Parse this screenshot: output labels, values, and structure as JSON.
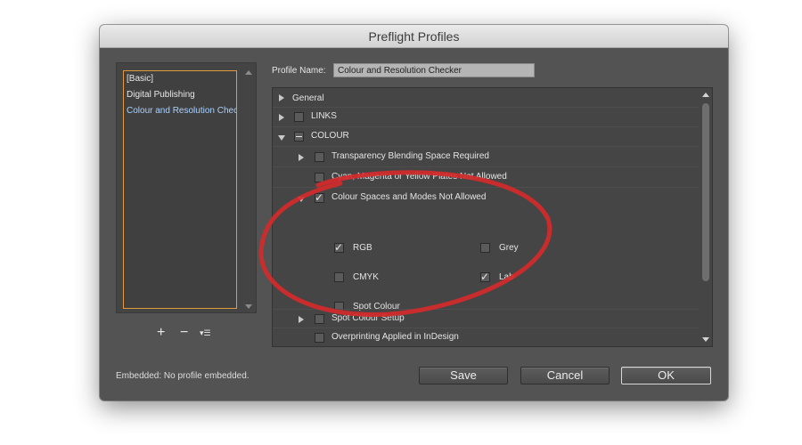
{
  "dialog": {
    "title": "Preflight Profiles"
  },
  "profiles": {
    "items": [
      "[Basic]",
      "Digital Publishing",
      "Colour and Resolution Chec"
    ],
    "selected_index": 2
  },
  "list_tools": {
    "add": "+",
    "remove": "−",
    "menu": "▾☰"
  },
  "profile_name": {
    "label": "Profile Name:",
    "value": "Colour and Resolution Checker"
  },
  "tree": {
    "general": "General",
    "links": "LINKS",
    "colour": "COLOUR",
    "transparency": "Transparency Blending Space Required",
    "cmy_plates": "Cyan, Magenta or Yellow Plates Not Allowed",
    "colour_spaces": "Colour Spaces and Modes Not Allowed",
    "options": {
      "rgb": {
        "label": "RGB",
        "checked": true
      },
      "grey": {
        "label": "Grey",
        "checked": false
      },
      "cmyk": {
        "label": "CMYK",
        "checked": false
      },
      "lab": {
        "label": "Lab",
        "checked": true
      },
      "spot": {
        "label": "Spot Colour",
        "checked": false
      }
    },
    "spot_setup": "Spot Colour Setup",
    "overprinting": "Overprinting Applied in InDesign"
  },
  "footer": {
    "embedded": "Embedded: No profile embedded.",
    "save": "Save",
    "cancel": "Cancel",
    "ok": "OK"
  },
  "colors": {
    "annotation": "#d42a2a",
    "selection_text": "#a9d1ff",
    "list_border": "#e09b3e"
  }
}
